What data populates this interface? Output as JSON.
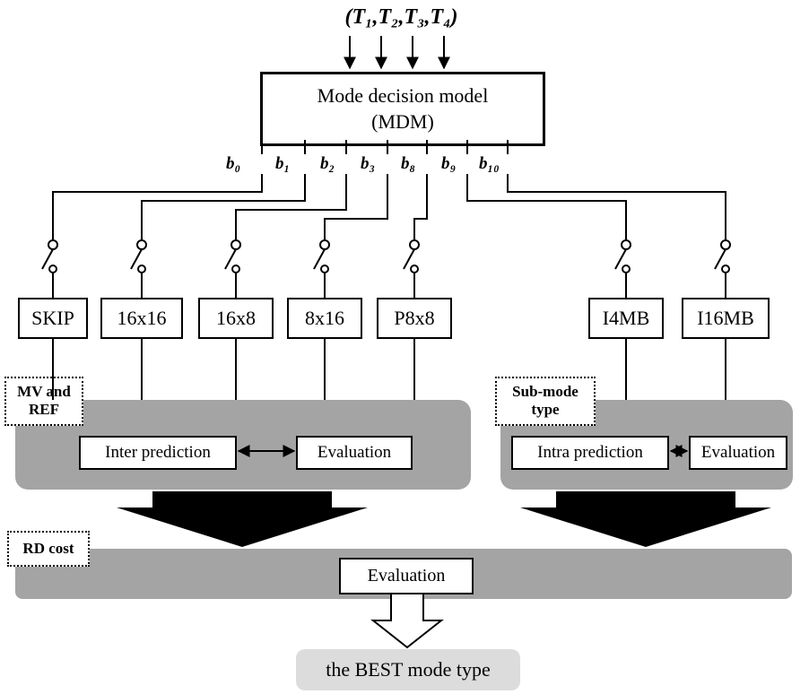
{
  "chart_data": {
    "type": "diagram",
    "title": "Mode decision model flow",
    "inputs": [
      "T1",
      "T2",
      "T3",
      "T4"
    ],
    "outputs_b": [
      "b0",
      "b1",
      "b2",
      "b3",
      "b8",
      "b9",
      "b10"
    ],
    "modes": [
      "SKIP",
      "16x16",
      "16x8",
      "8x16",
      "P8x8",
      "I4MB",
      "I16MB"
    ],
    "inter_stage": {
      "tag": "MV and REF",
      "blocks": [
        "Inter prediction",
        "Evaluation"
      ]
    },
    "intra_stage": {
      "tag": "Sub-mode type",
      "blocks": [
        "Intra prediction",
        "Evaluation"
      ]
    },
    "final_stage": {
      "tag": "RD cost",
      "block": "Evaluation"
    },
    "result": "the BEST mode type"
  },
  "top": {
    "inputs": "(T₁,T₂,T₃,T₄)"
  },
  "mdm": {
    "line1": "Mode decision model",
    "line2": "(MDM)"
  },
  "b": {
    "b0": "b₀",
    "b1": "b₁",
    "b2": "b₂",
    "b3": "b₃",
    "b8": "b₈",
    "b9": "b₉",
    "b10": "b₁₀"
  },
  "modes": {
    "skip": "SKIP",
    "m16x16": "16x16",
    "m16x8": "16x8",
    "m8x16": "8x16",
    "p8x8": "P8x8",
    "i4mb": "I4MB",
    "i16mb": "I16MB"
  },
  "tags": {
    "mvref_l1": "MV and",
    "mvref_l2": "REF",
    "submode_l1": "Sub-mode",
    "submode_l2": "type",
    "rdcost": "RD cost"
  },
  "pred": {
    "inter": "Inter prediction",
    "eval": "Evaluation",
    "intra": "Intra prediction"
  },
  "final": {
    "eval": "Evaluation",
    "result": "the BEST mode type"
  }
}
